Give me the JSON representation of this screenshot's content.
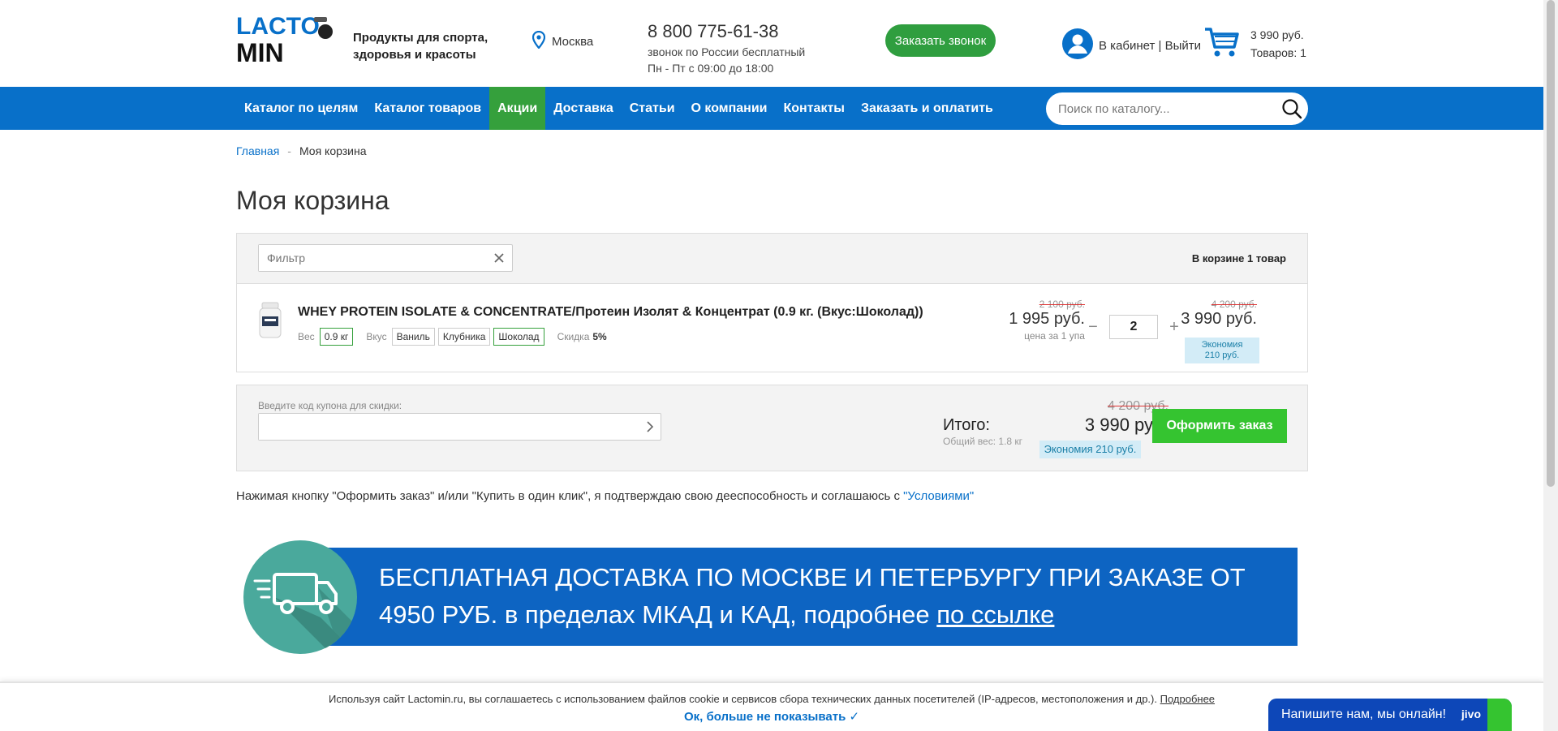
{
  "header": {
    "logo_top": "LACTO",
    "logo_bottom": "MIN",
    "tagline": "Продукты для спорта, здоровья и красоты",
    "city": "Москва",
    "phone": "8 800 775-61-38",
    "phone_note": "звонок по России бесплатный",
    "hours": "Пн - Пт с 09:00 до 18:00",
    "callback_label": "Заказать звонок",
    "account_label": "В кабинет | Выйти",
    "cart_sum": "3 990 руб.",
    "cart_count": "Товаров: 1"
  },
  "nav": {
    "items": [
      {
        "label": "Каталог по целям"
      },
      {
        "label": "Каталог товаров"
      },
      {
        "label": "Акции"
      },
      {
        "label": "Доставка"
      },
      {
        "label": "Статьи"
      },
      {
        "label": "О компании"
      },
      {
        "label": "Контакты"
      },
      {
        "label": "Заказать и оплатить"
      }
    ],
    "active_index": 2,
    "search_placeholder": "Поиск по каталогу..."
  },
  "breadcrumb": {
    "home": "Главная",
    "sep": "-",
    "current": "Моя корзина"
  },
  "page_title": "Моя корзина",
  "cart": {
    "filter_placeholder": "Фильтр",
    "count_text": "В корзине 1 товар",
    "item": {
      "title": "WHEY PROTEIN ISOLATE & CONCENTRATE/Протеин Изолят & Концентрат (0.9 кг. (Вкус:Шоколад))",
      "weight_label": "Вес",
      "weight_value": "0.9 кг",
      "flavor_label": "Вкус",
      "flavors": [
        "Ваниль",
        "Клубника",
        "Шоколад"
      ],
      "flavor_selected": 2,
      "discount_label": "Скидка",
      "discount_value": "5%",
      "unit_old": "2 100 руб.",
      "unit_new": "1 995 руб.",
      "unit_note": "цена за 1 упа",
      "qty_minus": "−",
      "qty": "2",
      "qty_plus": "+",
      "total_old": "4 200 руб.",
      "total_new": "3 990 руб.",
      "save_line1": "Экономия",
      "save_line2": "210 руб."
    }
  },
  "totals": {
    "coupon_label": "Введите код купона для скидки:",
    "itogo": "Итого:",
    "weight": "Общий вес: 1.8 кг",
    "old": "4 200 руб.",
    "new": "3 990 руб.",
    "save": "Экономия 210 руб.",
    "checkout_label": "Оформить заказ"
  },
  "consent": {
    "text": "Нажимая кнопку \"Оформить заказ\" и/или \"Купить в один клик\", я подтверждаю свою дееспособность и соглашаюсь с ",
    "link": "\"Условиями\""
  },
  "banner": {
    "text": "БЕСПЛАТНАЯ ДОСТАВКА ПО МОСКВЕ И ПЕТЕРБУРГУ ПРИ ЗАКАЗЕ ОТ 4950 РУБ. в пределах МКАД и КАД, подробнее ",
    "link": "по ссылке"
  },
  "cookie": {
    "text": "Используя сайт Lactomin.ru, вы соглашаетесь с использованием файлов cookie и сервисов сбора технических данных посетителей (IP-адресов, местоположения и др.). ",
    "link": "Подробнее",
    "ok": "Ок, больше не показывать ✓"
  },
  "chat": {
    "label": "Напишите нам, мы онлайн!",
    "logo": "jivo"
  },
  "colors": {
    "brand_blue": "#0870c9",
    "accent_green": "#35a03c",
    "checkout_green": "#35c430",
    "banner_blue": "#0d64c2"
  }
}
